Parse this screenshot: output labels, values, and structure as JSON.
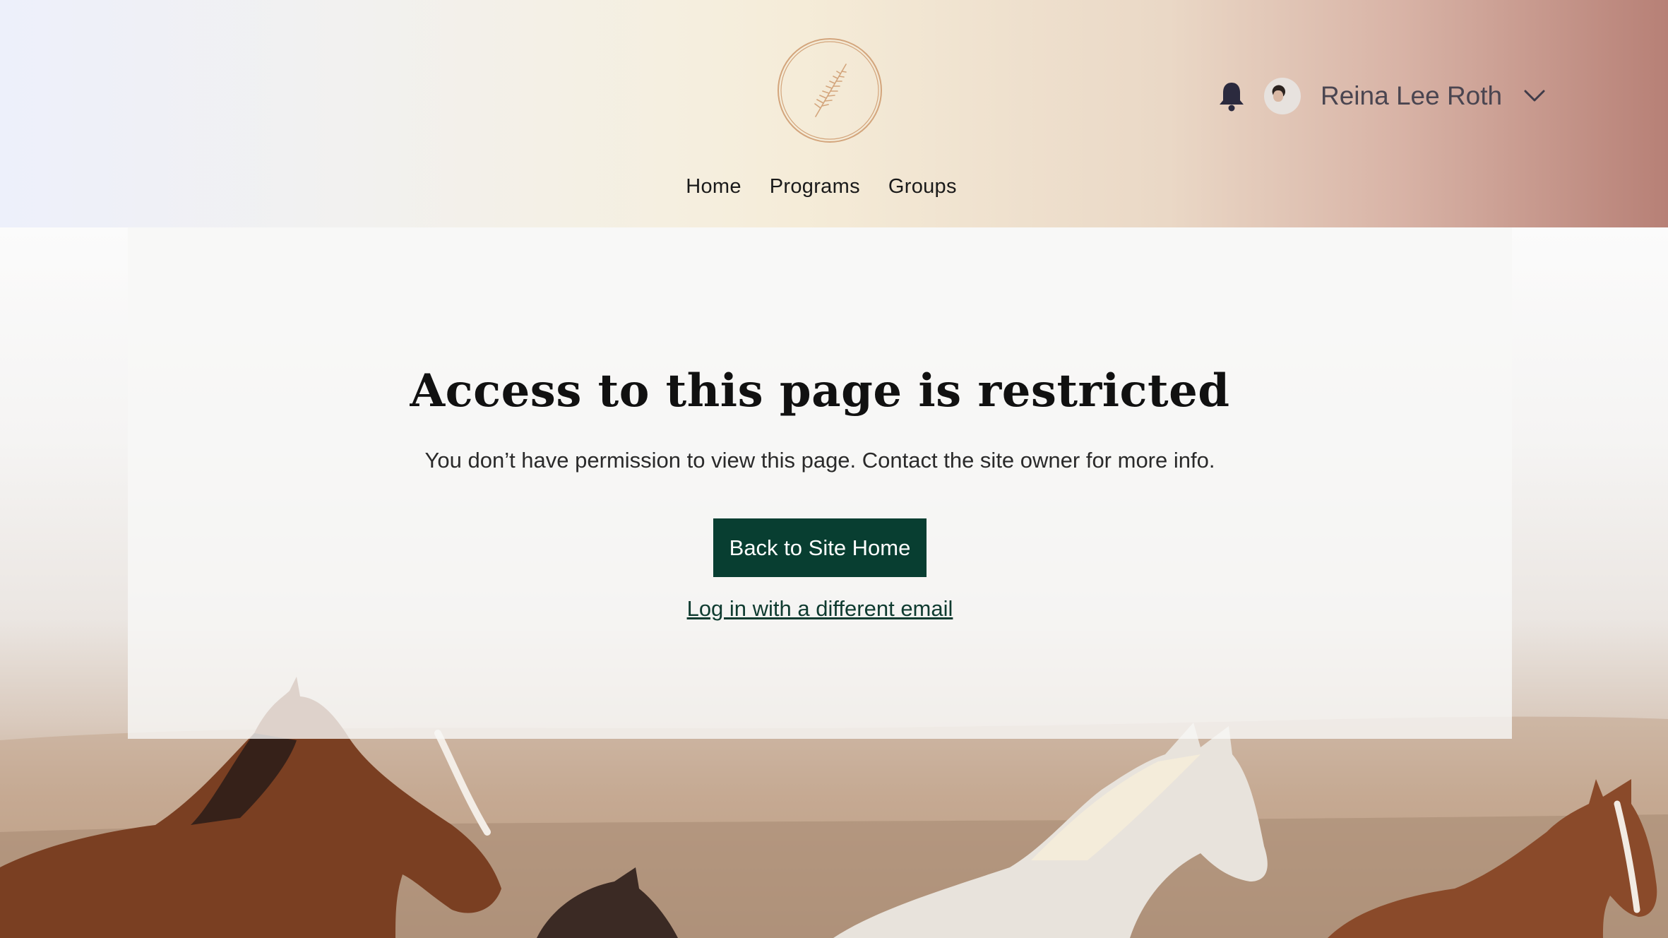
{
  "header": {
    "logo_icon": "botanical-sprig-emblem",
    "nav": [
      {
        "label": "Home"
      },
      {
        "label": "Programs"
      },
      {
        "label": "Groups"
      }
    ],
    "user": {
      "name": "Reina Lee Roth",
      "bell_icon": "bell-icon",
      "menu_icon": "chevron-down-icon"
    }
  },
  "main": {
    "title": "Access to this page is restricted",
    "message": "You don’t have permission to view this page. Contact the site owner for more info.",
    "primary_button": "Back to Site Home",
    "secondary_link": "Log in with a different email"
  },
  "colors": {
    "button": "#083e31",
    "logo": "#d3a57c",
    "text_dark": "#111111"
  }
}
